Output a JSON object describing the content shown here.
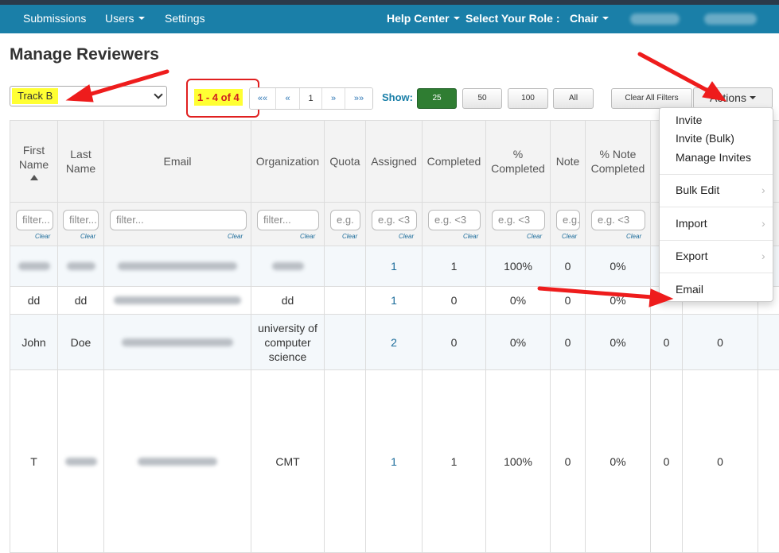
{
  "navbar": {
    "submissions": "Submissions",
    "users": "Users",
    "settings": "Settings",
    "help_center": "Help Center",
    "select_role_label": "Select Your Role :",
    "role_value": "Chair"
  },
  "page_title": "Manage Reviewers",
  "track_select": {
    "selected": "Track B"
  },
  "pagination": {
    "count_text": "1 - 4 of 4",
    "first": "««",
    "prev": "«",
    "current": "1",
    "next": "»",
    "last": "»»"
  },
  "page_size": {
    "label": "Show:",
    "options": [
      "25",
      "50",
      "100",
      "All"
    ],
    "selected": "25",
    "active_color": "#2f7d32"
  },
  "toolbar": {
    "clear_all_filters": "Clear All Filters",
    "actions": "Actions"
  },
  "table": {
    "headers": {
      "first_name": "First Name",
      "last_name": "Last Name",
      "email": "Email",
      "organization": "Organization",
      "quota": "Quota",
      "assigned": "Assigned",
      "completed": "Completed",
      "pct_completed": "% Completed",
      "note": "Note",
      "pct_note_completed": "% Note Completed"
    },
    "filter_placeholders": {
      "text": "filter...",
      "quota": "e.g.",
      "numeric": "e.g. <3",
      "clear": "Clear"
    },
    "rows": [
      {
        "first_name": "",
        "last_name": "",
        "email": "",
        "organization": "",
        "assigned": "1",
        "completed": "1",
        "pct_completed": "100%",
        "note": "0",
        "pct_note_completed": "0%",
        "col_b": "",
        "col_c": ""
      },
      {
        "first_name": "dd",
        "last_name": "dd",
        "email": "",
        "organization": "dd",
        "assigned": "1",
        "completed": "0",
        "pct_completed": "0%",
        "note": "0",
        "pct_note_completed": "0%",
        "col_b": "",
        "col_c": ""
      },
      {
        "first_name": "John",
        "last_name": "Doe",
        "email": "",
        "organization": "university of computer science",
        "assigned": "2",
        "completed": "0",
        "pct_completed": "0%",
        "note": "0",
        "pct_note_completed": "0%",
        "col_b": "0",
        "col_c": "0"
      },
      {
        "first_name": "T",
        "last_name": "",
        "email": "",
        "organization": "CMT",
        "assigned": "1",
        "completed": "1",
        "pct_completed": "100%",
        "note": "0",
        "pct_note_completed": "0%",
        "col_b": "0",
        "col_c": "0"
      }
    ]
  },
  "actions_menu": {
    "items": {
      "invite": "Invite",
      "invite_bulk": "Invite (Bulk)",
      "manage_invites": "Manage Invites",
      "bulk_edit": "Bulk Edit",
      "import": "Import",
      "export": "Export",
      "email": "Email"
    }
  },
  "annotations": {
    "arrow_color": "#ee1c1c",
    "highlight_color": "#ffff33"
  },
  "icons": [
    "sort-ascending-icon",
    "dropdown-chevron-icon",
    "submenu-arrow-icon",
    "annotation-arrow"
  ]
}
